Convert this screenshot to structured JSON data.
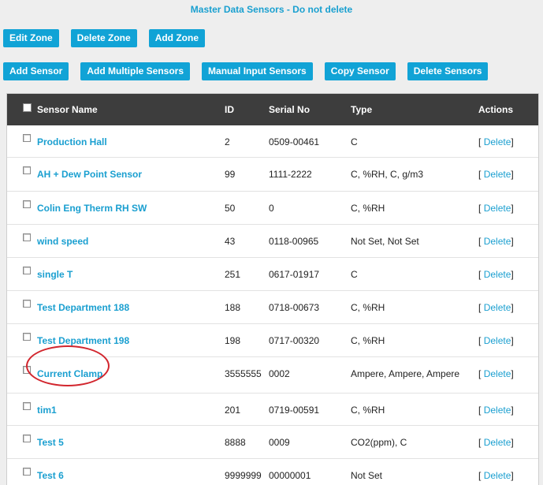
{
  "page_title": "Master Data Sensors - Do not delete",
  "zone_buttons": [
    "Edit Zone",
    "Delete Zone",
    "Add Zone"
  ],
  "sensor_buttons": [
    "Add Sensor",
    "Add Multiple Sensors",
    "Manual Input Sensors",
    "Copy Sensor",
    "Delete Sensors"
  ],
  "table": {
    "headers": {
      "name": "Sensor Name",
      "id": "ID",
      "serial": "Serial No",
      "type": "Type",
      "actions": "Actions"
    },
    "rows": [
      {
        "name": "Production Hall",
        "id": "2",
        "serial": "0509-00461",
        "type": "C"
      },
      {
        "name": "AH + Dew Point Sensor",
        "id": "99",
        "serial": "1111-2222",
        "type": "C, %RH, C, g/m3"
      },
      {
        "name": "Colin Eng Therm RH SW",
        "id": "50",
        "serial": "0",
        "type": "C, %RH"
      },
      {
        "name": "wind speed",
        "id": "43",
        "serial": "0118-00965",
        "type": "Not Set, Not Set"
      },
      {
        "name": "single T",
        "id": "251",
        "serial": "0617-01917",
        "type": "C"
      },
      {
        "name": "Test Department 188",
        "id": "188",
        "serial": "0718-00673",
        "type": "C, %RH"
      },
      {
        "name": "Test Department 198",
        "id": "198",
        "serial": "0717-00320",
        "type": "C, %RH"
      },
      {
        "name": "Current Clamp",
        "id": "3555555",
        "serial": "0002",
        "type": "Ampere, Ampere, Ampere"
      },
      {
        "name": "tim1",
        "id": "201",
        "serial": "0719-00591",
        "type": "C, %RH"
      },
      {
        "name": "Test 5",
        "id": "8888",
        "serial": "0009",
        "type": "CO2(ppm), C"
      },
      {
        "name": "Test 6",
        "id": "9999999",
        "serial": "00000001",
        "type": "Not Set"
      }
    ],
    "action_open": "[",
    "action_label": "Delete",
    "action_close": "]"
  },
  "colors": {
    "accent": "#11a3d6",
    "header_bg": "#3d3d3d",
    "annotation": "#d2262e"
  }
}
